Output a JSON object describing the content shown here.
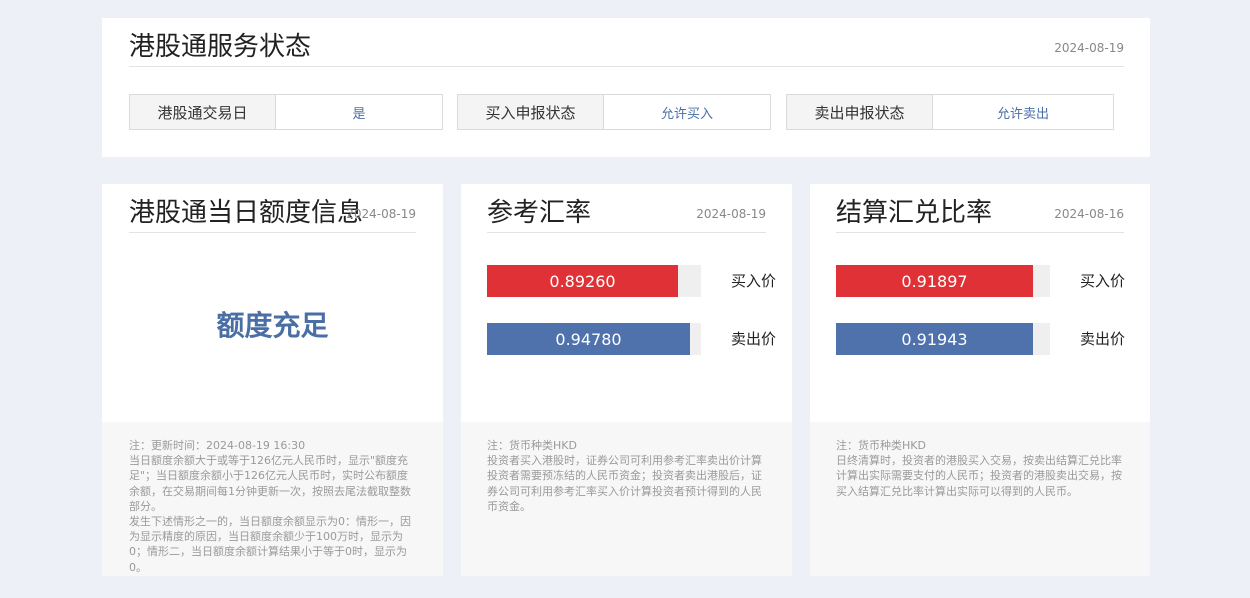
{
  "service": {
    "title": "港股通服务状态",
    "date": "2024-08-19",
    "items": [
      {
        "label": "港股通交易日",
        "value": "是"
      },
      {
        "label": "买入申报状态",
        "value": "允许买入"
      },
      {
        "label": "卖出申报状态",
        "value": "允许卖出"
      }
    ]
  },
  "quota": {
    "title": "港股通当日额度信息",
    "date": "2024-08-19",
    "status": "额度充足",
    "note": {
      "lines": [
        "注：更新时间：2024-08-19 16:30",
        "当日额度余额大于或等于126亿元人民币时，显示\"额度充足\"；当日额度余额小于126亿元人民币时，实时公布额度余额，在交易期间每1分钟更新一次，按照去尾法截取整数部分。",
        "发生下述情形之一的，当日额度余额显示为0：情形一，因为显示精度的原因，当日额度余额少于100万时，显示为0；情形二，当日额度余额计算结果小于等于0时，显示为0。"
      ]
    }
  },
  "reference_rate": {
    "title": "参考汇率",
    "date": "2024-08-19",
    "buy": {
      "label": "买入价",
      "value": "0.89260",
      "fill": 0.893,
      "color": "#e03236"
    },
    "sell": {
      "label": "卖出价",
      "value": "0.94780",
      "fill": 0.948,
      "color": "#4f72ad"
    },
    "note": {
      "lines": [
        "注：货币种类HKD",
        "投资者买入港股时，证券公司可利用参考汇率卖出价计算投资者需要预冻结的人民币资金；投资者卖出港股后，证券公司可利用参考汇率买入价计算投资者预计得到的人民币资金。"
      ]
    }
  },
  "settlement_rate": {
    "title": "结算汇兑比率",
    "date": "2024-08-16",
    "buy": {
      "label": "买入价",
      "value": "0.91897",
      "fill": 0.919,
      "color": "#e03236"
    },
    "sell": {
      "label": "卖出价",
      "value": "0.91943",
      "fill": 0.919,
      "color": "#4f72ad"
    },
    "note": {
      "lines": [
        "注：货币种类HKD",
        "日终清算时，投资者的港股买入交易，按卖出结算汇兑比率计算出实际需要支付的人民币；投资者的港股卖出交易，按买入结算汇兑比率计算出实际可以得到的人民币。"
      ]
    }
  }
}
